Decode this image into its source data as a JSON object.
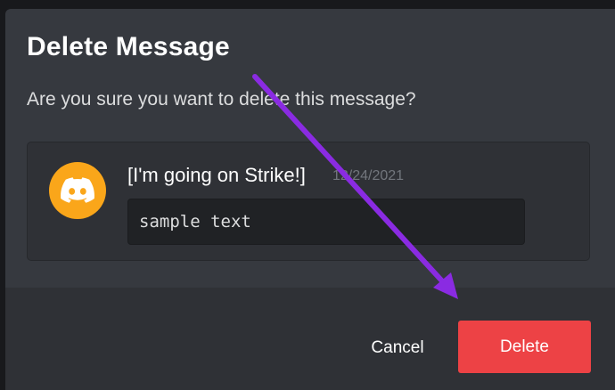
{
  "modal": {
    "title": "Delete Message",
    "description": "Are you sure you want to delete this message?"
  },
  "message_preview": {
    "avatar_icon": "discord-logo-icon",
    "avatar_color": "#faa61a",
    "username": "[I'm going on Strike!]",
    "timestamp": "12/24/2021",
    "content": "sample text"
  },
  "actions": {
    "cancel_label": "Cancel",
    "delete_label": "Delete",
    "delete_color": "#ed4245"
  },
  "annotation": {
    "icon": "arrow-icon",
    "color": "#8a2be2"
  }
}
